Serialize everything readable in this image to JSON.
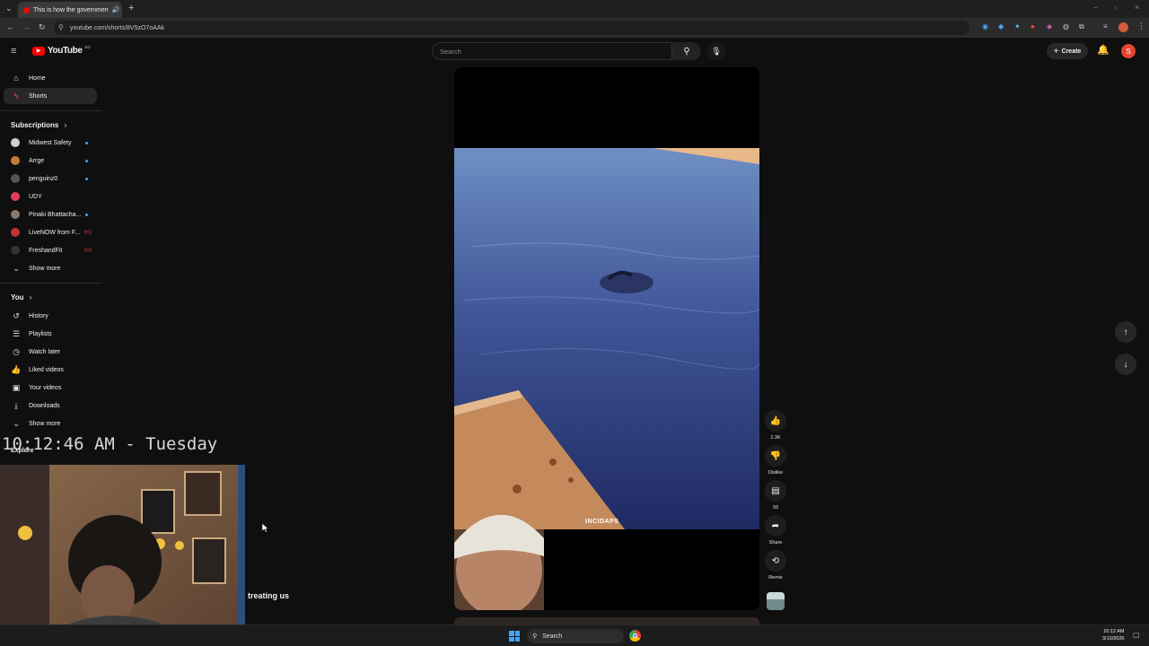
{
  "browser": {
    "tab_title": "This is how the governmen",
    "url": "youtube.com/shorts/8V5zO7oAAk"
  },
  "header": {
    "logo_text": "YouTube",
    "logo_region": "BD",
    "search_placeholder": "Search",
    "create_label": "Create",
    "avatar_letter": "S"
  },
  "sidebar": {
    "main": [
      {
        "label": "Home",
        "icon": "home-icon"
      },
      {
        "label": "Shorts",
        "icon": "shorts-icon"
      }
    ],
    "subscriptions_title": "Subscriptions",
    "subscriptions": [
      {
        "label": "Midwest Safety",
        "color": "#d0d0d0",
        "badge": "dot"
      },
      {
        "label": "Arrge",
        "color": "#c47b3a",
        "badge": "dot"
      },
      {
        "label": "penguinz0",
        "color": "#555555",
        "badge": "dot"
      },
      {
        "label": "UDY",
        "color": "#e23b5c",
        "badge": ""
      },
      {
        "label": "Pinaki Bhattacha...",
        "color": "#8a7a6a",
        "badge": "dot"
      },
      {
        "label": "LiveNOW from F...",
        "color": "#c23333",
        "badge": "live"
      },
      {
        "label": "FreshandFit",
        "color": "#333333",
        "badge": "live"
      }
    ],
    "show_more_1": "Show more",
    "you_title": "You",
    "you_items": [
      {
        "label": "History",
        "icon": "history-icon"
      },
      {
        "label": "Playlists",
        "icon": "playlists-icon"
      },
      {
        "label": "Watch later",
        "icon": "watch-later-icon"
      },
      {
        "label": "Liked videos",
        "icon": "liked-videos-icon"
      },
      {
        "label": "Your videos",
        "icon": "your-videos-icon"
      },
      {
        "label": "Downloads",
        "icon": "downloads-icon"
      }
    ],
    "show_more_2": "Show more",
    "explore_title": "Explore"
  },
  "overlay": {
    "clock": "10:12:46 AM - Tuesday",
    "caption": "treating us"
  },
  "video": {
    "watermark": "INCIDAPS"
  },
  "actions": {
    "like_count": "2.3K",
    "dislike_label": "Dislike",
    "comments_count": "59",
    "share_label": "Share",
    "remix_label": "Remix"
  },
  "taskbar": {
    "search_label": "Search",
    "time": "10:12 AM",
    "date": "3/10/2026"
  },
  "colors": {
    "youtube_red": "#ff0000",
    "accent_blue": "#3ea6ff"
  }
}
